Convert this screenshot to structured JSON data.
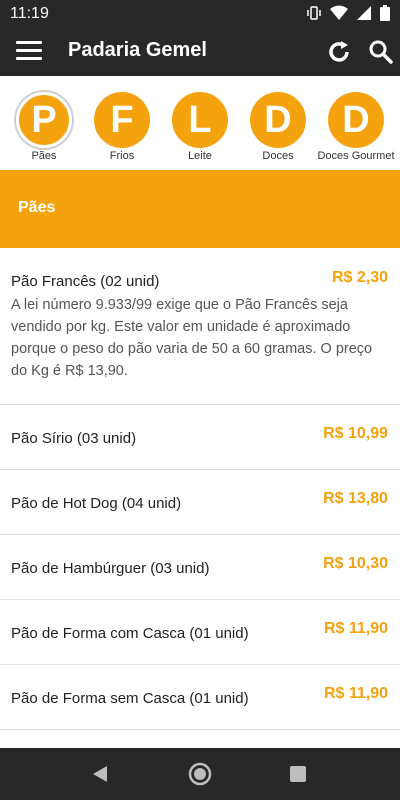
{
  "status_bar": {
    "time": "11:19"
  },
  "app_bar": {
    "title": "Padaria Gemel"
  },
  "categories": [
    {
      "letter": "P",
      "label": "Pães"
    },
    {
      "letter": "F",
      "label": "Frios"
    },
    {
      "letter": "L",
      "label": "Leite"
    },
    {
      "letter": "D",
      "label": "Doces"
    },
    {
      "letter": "D",
      "label": "Doces Gourmet"
    }
  ],
  "section": {
    "title": "Pães"
  },
  "items": [
    {
      "name": "Pão Francês (02 unid)",
      "price": "R$ 2,30",
      "description": "A lei número 9.933/99 exige que o Pão Francês seja vendido por kg. Este valor em unidade é aproximado porque o peso do pão varia de 50 a 60 gramas. O preço do Kg é R$ 13,90."
    },
    {
      "name": "Pão Sírio (03 unid)",
      "price": "R$ 10,99"
    },
    {
      "name": "Pão de Hot Dog (04 unid)",
      "price": "R$ 13,80"
    },
    {
      "name": "Pão de Hambúrguer (03 unid)",
      "price": "R$ 10,30"
    },
    {
      "name": "Pão de Forma com Casca (01 unid)",
      "price": "R$ 11,90"
    },
    {
      "name": "Pão de Forma sem Casca (01 unid)",
      "price": "R$ 11,90"
    }
  ],
  "colors": {
    "accent": "#f4a20e",
    "bar": "#282828"
  }
}
